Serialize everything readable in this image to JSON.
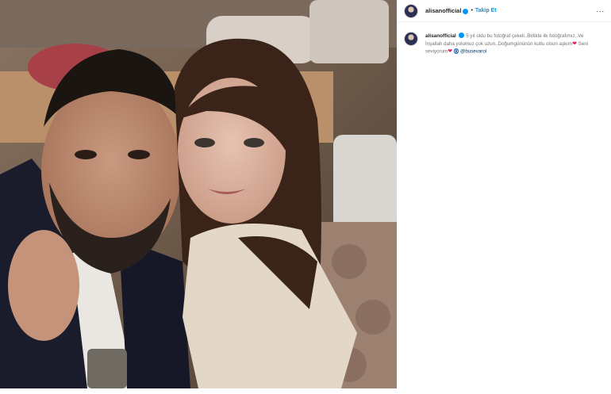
{
  "post": {
    "username": "alisanofficial",
    "separator": "•",
    "follow_label": "Takip Et",
    "more_label": "...",
    "caption": {
      "username": "alisanofficial",
      "text_1": "5 yıl oldu bu fotoğraf çekeli..Birlikte ilk fotoğrafımız..Ve İnşallah daha yolumuz çok uzun..Doğumgününün kutlu olsun aşkım",
      "text_2": "Seni seviyorum",
      "mention": "@busevarol"
    }
  },
  "icons": {
    "verified": "verified-badge-icon",
    "heart": "red-heart-icon",
    "evil_eye": "nazar-amulet-icon",
    "more": "more-options-icon"
  },
  "colors": {
    "accent": "#0095f6",
    "heart": "#e0245e",
    "mention": "#00376b"
  }
}
